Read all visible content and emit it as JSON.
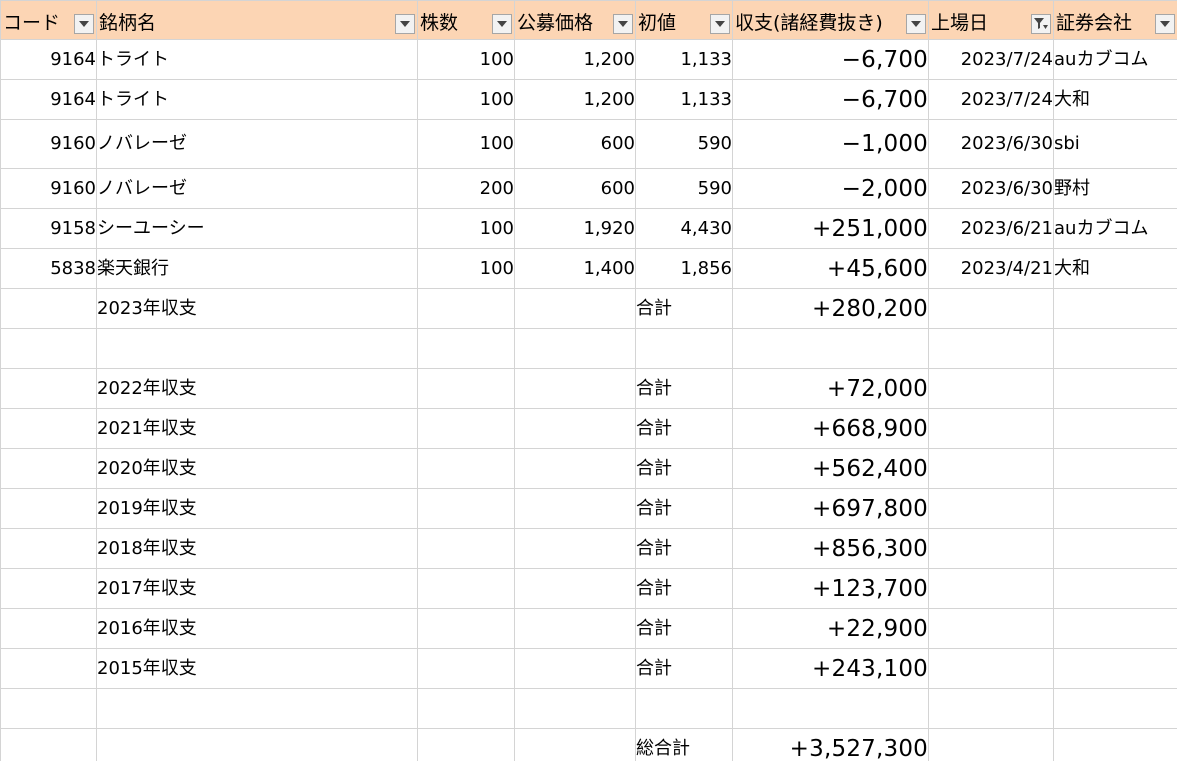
{
  "headers": {
    "code": "コード",
    "name": "銘柄名",
    "shares": "株数",
    "offer_price": "公募価格",
    "first_price": "初値",
    "profit": "収支(諸経費抜き)",
    "listing_date": "上場日",
    "broker": "証券会社"
  },
  "rows": [
    {
      "code": "9164",
      "name": "トライト",
      "shares": "100",
      "offer": "1,200",
      "first": "1,133",
      "profit": "−6,700",
      "date": "2023/7/24",
      "broker": "auカブコム"
    },
    {
      "code": "9164",
      "name": "トライト",
      "shares": "100",
      "offer": "1,200",
      "first": "1,133",
      "profit": "−6,700",
      "date": "2023/7/24",
      "broker": "大和"
    },
    {
      "code": "9160",
      "name": "ノバレーゼ",
      "shares": "100",
      "offer": "600",
      "first": "590",
      "profit": "−1,000",
      "date": "2023/6/30",
      "broker": "sbi"
    },
    {
      "code": "9160",
      "name": "ノバレーゼ",
      "shares": "200",
      "offer": "600",
      "first": "590",
      "profit": "−2,000",
      "date": "2023/6/30",
      "broker": "野村"
    },
    {
      "code": "9158",
      "name": "シーユーシー",
      "shares": "100",
      "offer": "1,920",
      "first": "4,430",
      "profit": "+251,000",
      "date": "2023/6/21",
      "broker": "auカブコム"
    },
    {
      "code": "5838",
      "name": "楽天銀行",
      "shares": "100",
      "offer": "1,400",
      "first": "1,856",
      "profit": "+45,600",
      "date": "2023/4/21",
      "broker": "大和"
    }
  ],
  "summary": [
    {
      "label": "2023年収支",
      "kind": "合計",
      "value": "+280,200"
    },
    {
      "label": "",
      "kind": "",
      "value": ""
    },
    {
      "label": "2022年収支",
      "kind": "合計",
      "value": "+72,000"
    },
    {
      "label": "2021年収支",
      "kind": "合計",
      "value": "+668,900"
    },
    {
      "label": "2020年収支",
      "kind": "合計",
      "value": "+562,400"
    },
    {
      "label": "2019年収支",
      "kind": "合計",
      "value": "+697,800"
    },
    {
      "label": "2018年収支",
      "kind": "合計",
      "value": "+856,300"
    },
    {
      "label": "2017年収支",
      "kind": "合計",
      "value": "+123,700"
    },
    {
      "label": "2016年収支",
      "kind": "合計",
      "value": "+22,900"
    },
    {
      "label": "2015年収支",
      "kind": "合計",
      "value": "+243,100"
    },
    {
      "label": "",
      "kind": "",
      "value": ""
    },
    {
      "label": "",
      "kind": "総合計",
      "value": "+3,527,300"
    }
  ],
  "colors": {
    "header_bg": "#fcd5b4",
    "gridline": "#d4d4d4"
  },
  "icons": {
    "filter_dropdown": "chevron-down-icon",
    "active_filter": "funnel-icon"
  }
}
